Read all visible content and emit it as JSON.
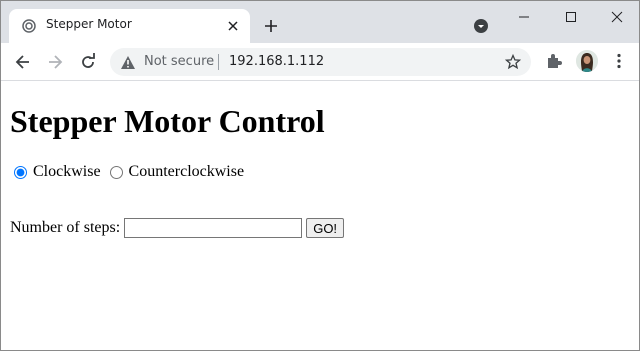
{
  "browser": {
    "tab_title": "Stepper Motor",
    "security_label": "Not secure",
    "url": "192.168.1.112"
  },
  "page": {
    "title": "Stepper Motor Control",
    "direction_options": [
      "Clockwise",
      "Counterclockwise"
    ],
    "selected_direction": "Clockwise",
    "steps_label": "Number of steps:",
    "steps_value": "",
    "go_label": "GO!"
  },
  "colors": {
    "tabstrip_bg": "#dee1e6",
    "omnibox_bg": "#f1f3f4",
    "radio_accent": "#1a73e8"
  }
}
